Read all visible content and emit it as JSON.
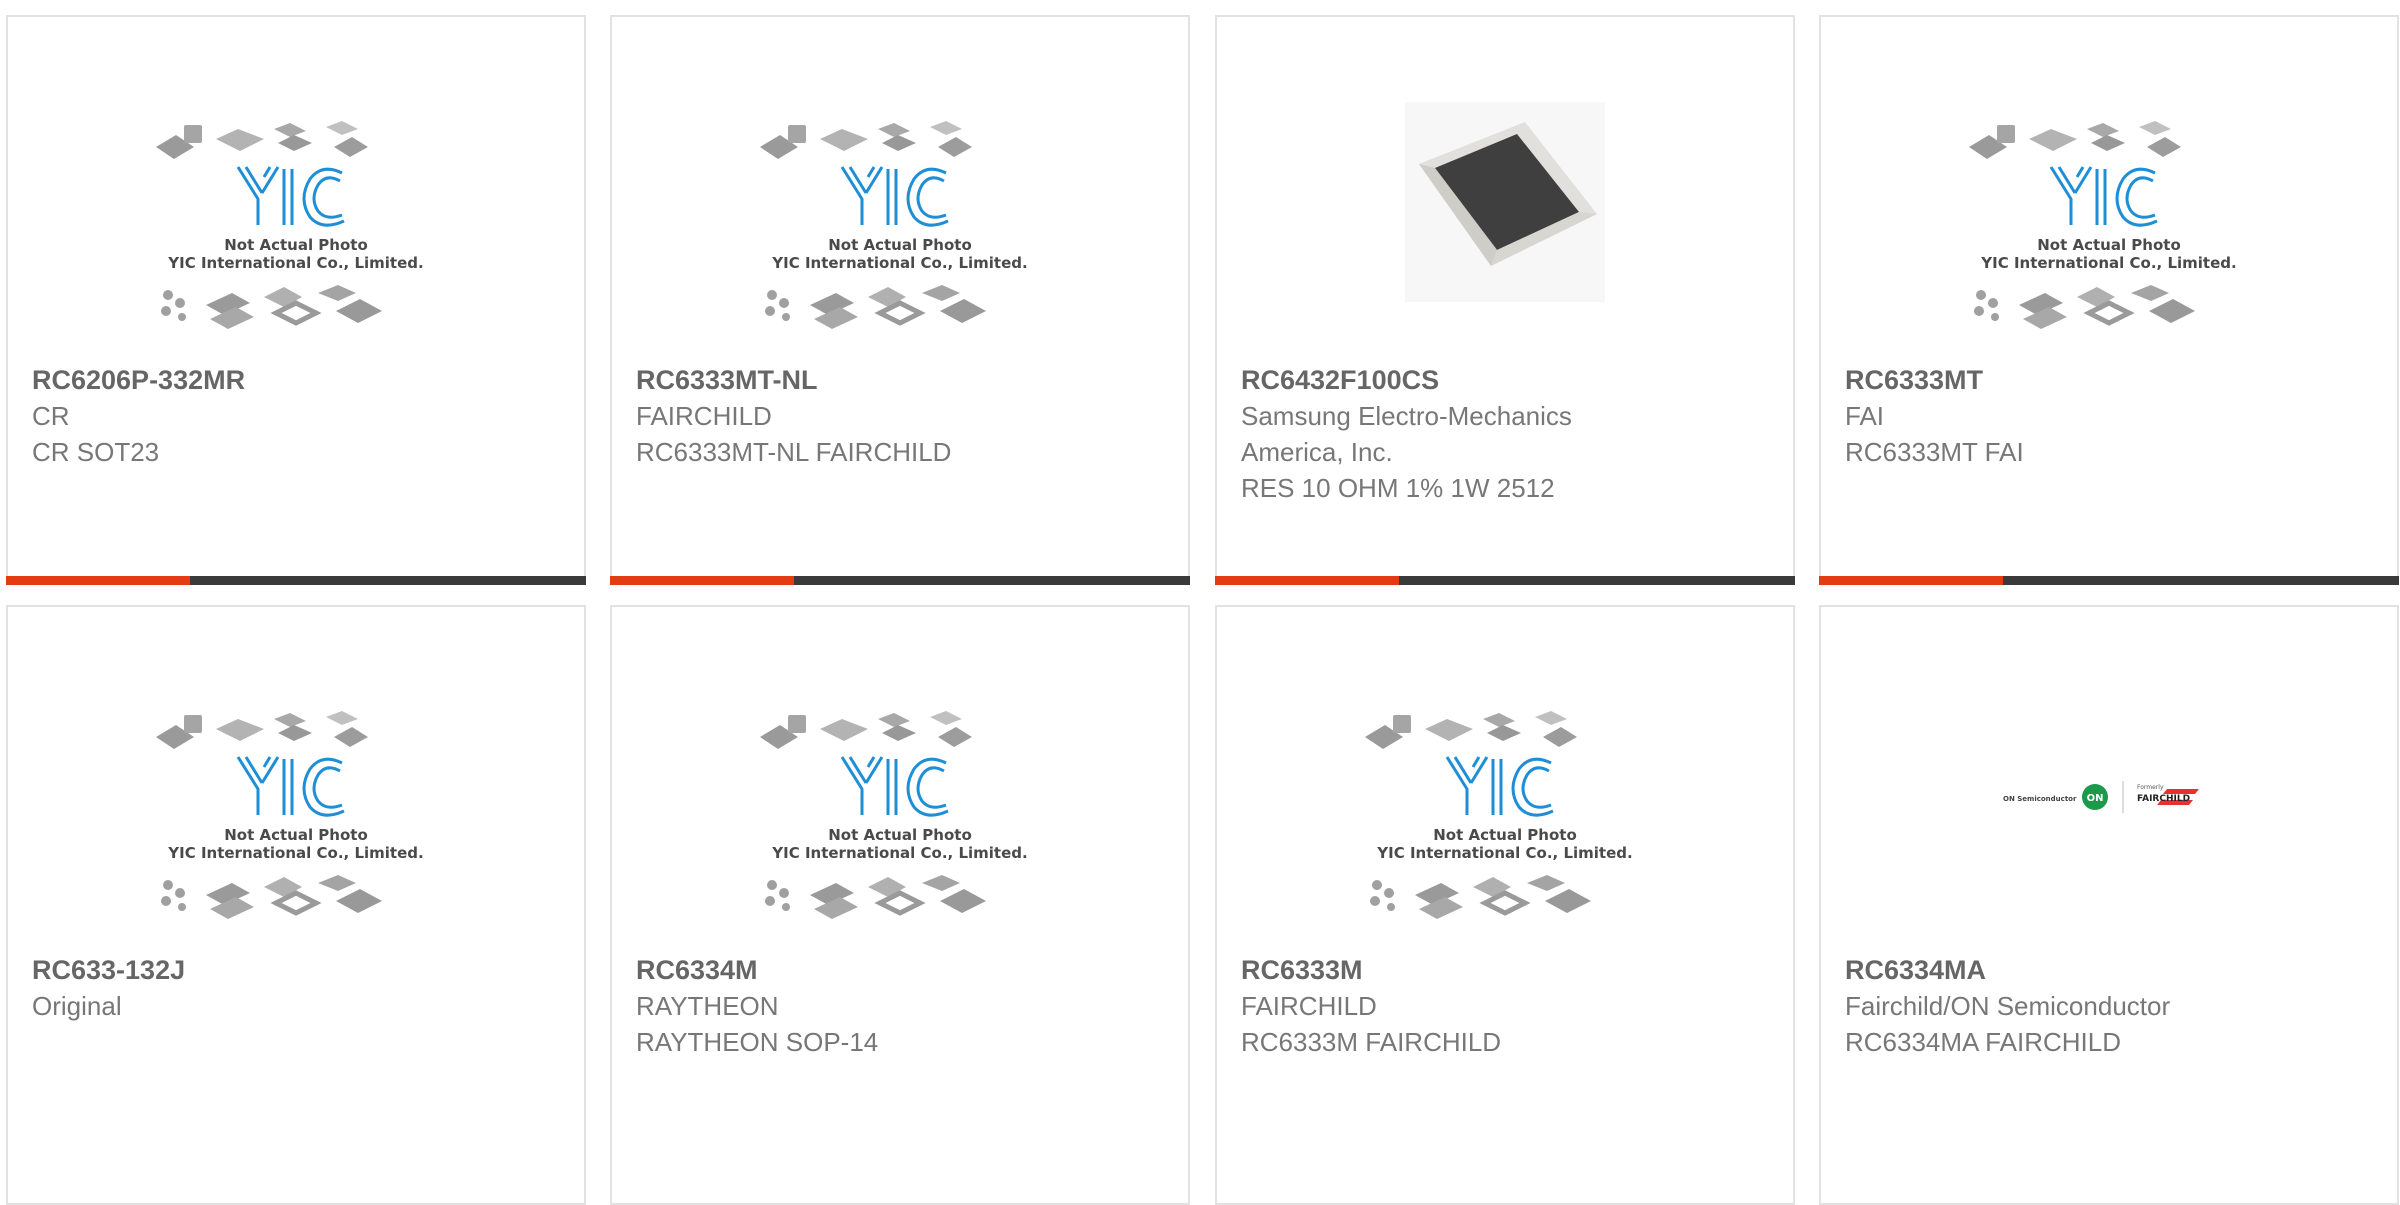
{
  "placeholder_caption": [
    "Not Actual Photo",
    "YIC International Co., Limited."
  ],
  "logo_text": "YIC",
  "colors": {
    "accent": "#e33b12",
    "bar": "#3a3a3a",
    "border": "#e2e2e2",
    "logo_blue": "#1e8fd6"
  },
  "products": [
    {
      "part_number": "RC6206P-332MR",
      "lines": [
        "CR",
        "CR SOT23"
      ],
      "image": "placeholder"
    },
    {
      "part_number": "RC6333MT-NL",
      "lines": [
        "FAIRCHILD",
        "RC6333MT-NL FAIRCHILD"
      ],
      "image": "placeholder"
    },
    {
      "part_number": "RC6432F100CS",
      "lines": [
        "Samsung Electro-Mechanics",
        "America, Inc.",
        "RES 10 OHM 1% 1W 2512"
      ],
      "image": "resistor-photo"
    },
    {
      "part_number": "RC6333MT",
      "lines": [
        "FAI",
        "RC6333MT FAI"
      ],
      "image": "placeholder"
    },
    {
      "part_number": "RC633-132J",
      "lines": [
        "Original"
      ],
      "image": "placeholder"
    },
    {
      "part_number": "RC6334M",
      "lines": [
        "RAYTHEON",
        "RAYTHEON SOP-14"
      ],
      "image": "placeholder"
    },
    {
      "part_number": "RC6333M",
      "lines": [
        "FAIRCHILD",
        "RC6333M FAIRCHILD"
      ],
      "image": "placeholder"
    },
    {
      "part_number": "RC6334MA",
      "lines": [
        "Fairchild/ON Semiconductor",
        "RC6334MA FAIRCHILD"
      ],
      "image": "onsemi-fairchild-logo"
    }
  ],
  "onsemi_logo": {
    "left_text": "ON Semiconductor",
    "badge": "ON",
    "formerly": "Formerly",
    "brand": "FAIRCHILD"
  }
}
